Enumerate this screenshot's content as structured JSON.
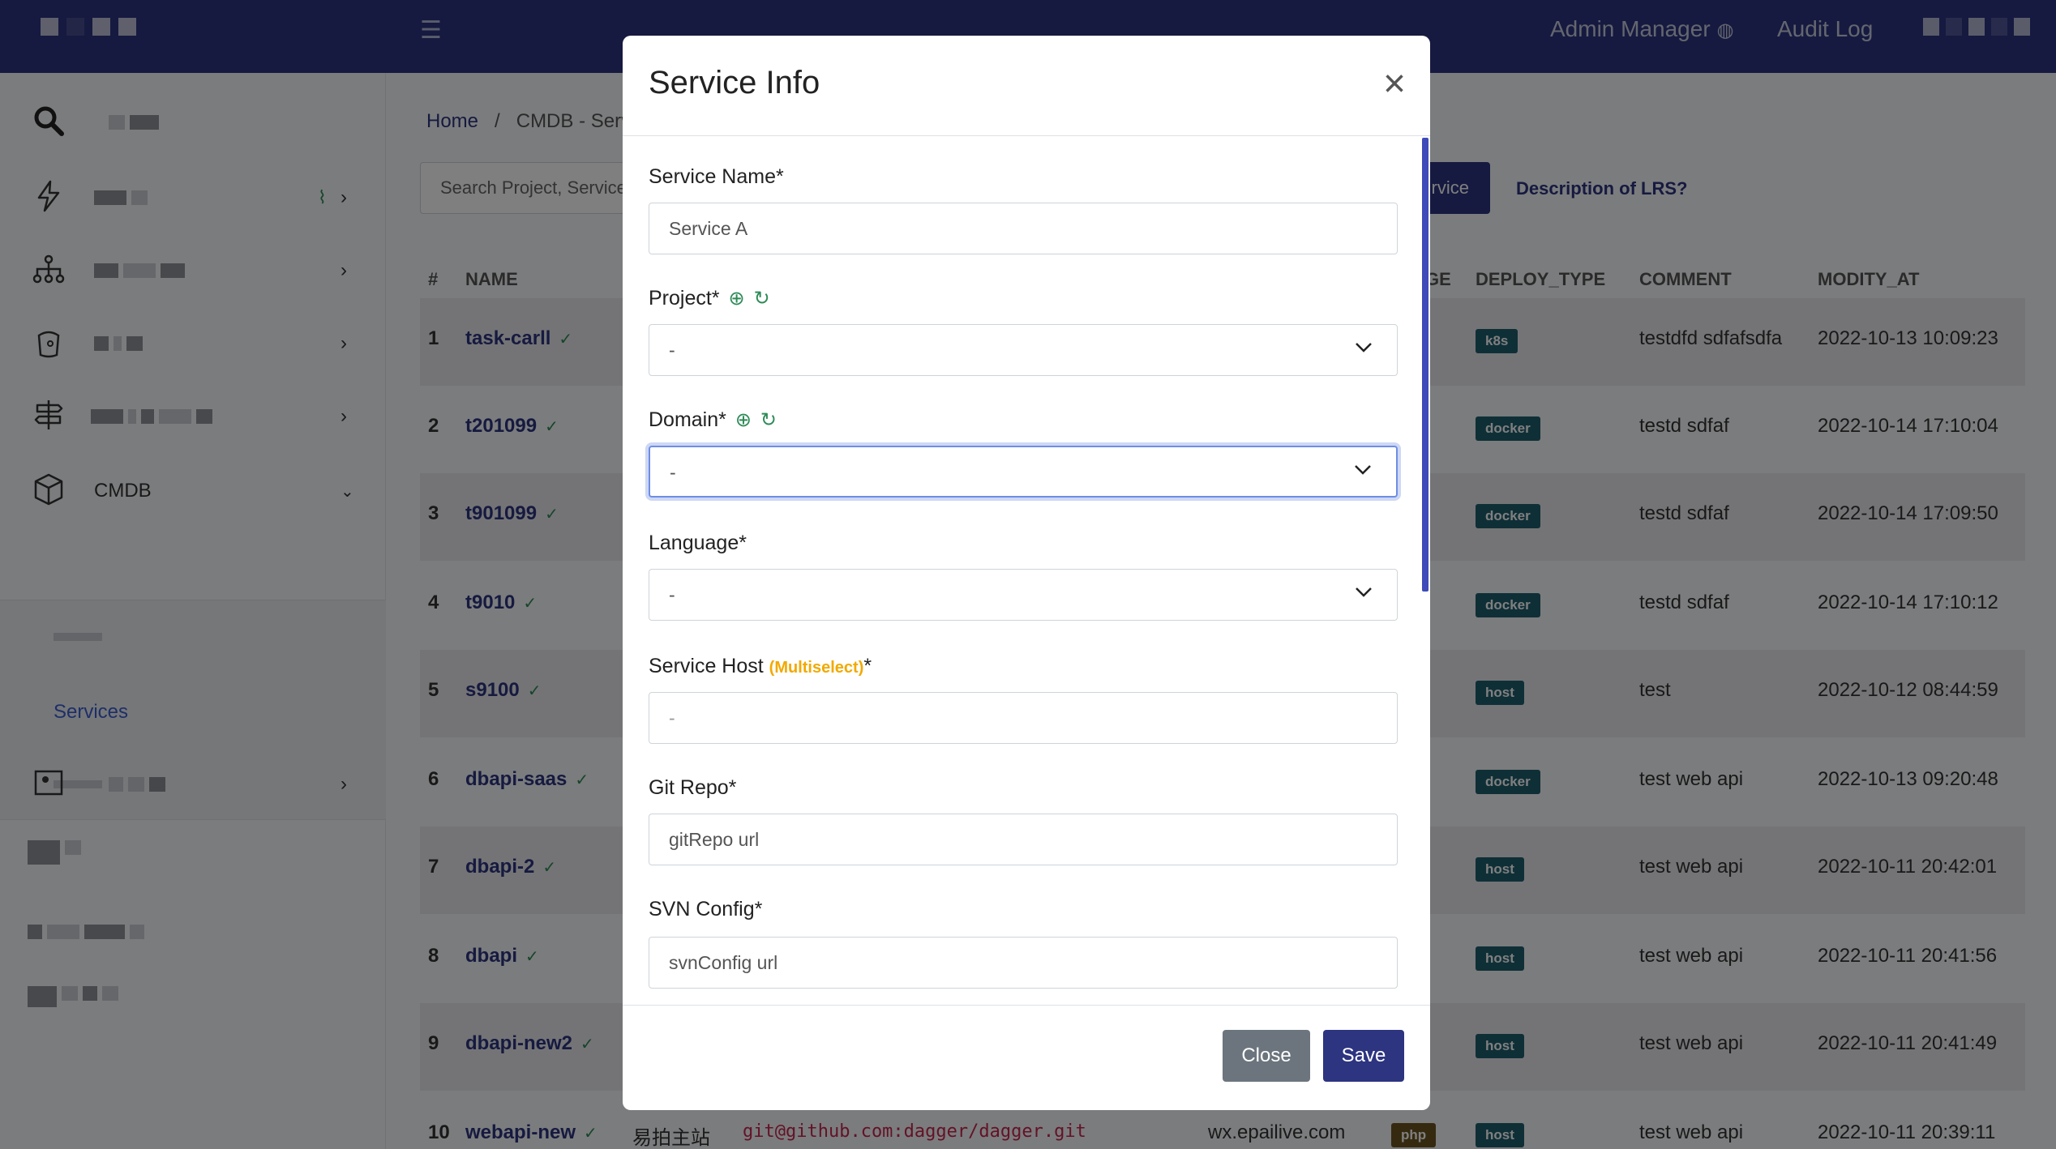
{
  "topbar": {
    "admin_label": "Admin Manager",
    "audit_label": "Audit Log"
  },
  "sidebar": {
    "cmdb_label": "CMDB",
    "services_label": "Services"
  },
  "main": {
    "breadcrumb_home": "Home",
    "breadcrumb_sep": "/",
    "breadcrumb_current": "CMDB - Servi",
    "search_placeholder": "Search Project, Service",
    "add_service_label": "rvice",
    "desc_link": "Description of LRS?",
    "columns": {
      "index": "#",
      "name": "NAME",
      "language_tail": "GE",
      "deploy_type": "DEPLOY_TYPE",
      "comment": "COMMENT",
      "modify_at": "MODITY_AT"
    },
    "rows": [
      {
        "index": "1",
        "name": "task-carll",
        "deploy": "k8s",
        "comment": "testdfd sdfafsdfa",
        "modify_at": "2022-10-13 10:09:23"
      },
      {
        "index": "2",
        "name": "t201099",
        "deploy": "docker",
        "comment": "testd sdfaf",
        "modify_at": "2022-10-14 17:10:04"
      },
      {
        "index": "3",
        "name": "t901099",
        "deploy": "docker",
        "comment": "testd sdfaf",
        "modify_at": "2022-10-14 17:09:50"
      },
      {
        "index": "4",
        "name": "t9010",
        "deploy": "docker",
        "comment": "testd sdfaf",
        "modify_at": "2022-10-14 17:10:12"
      },
      {
        "index": "5",
        "name": "s9100",
        "deploy": "host",
        "comment": "test",
        "modify_at": "2022-10-12 08:44:59"
      },
      {
        "index": "6",
        "name": "dbapi-saas",
        "deploy": "docker",
        "comment": "test web api",
        "modify_at": "2022-10-13 09:20:48"
      },
      {
        "index": "7",
        "name": "dbapi-2",
        "deploy": "host",
        "comment": "test web api",
        "modify_at": "2022-10-11 20:42:01"
      },
      {
        "index": "8",
        "name": "dbapi",
        "deploy": "host",
        "comment": "test web api",
        "modify_at": "2022-10-11 20:41:56"
      },
      {
        "index": "9",
        "name": "dbapi-new2",
        "deploy": "host",
        "comment": "test web api",
        "modify_at": "2022-10-11 20:41:49"
      },
      {
        "index": "10",
        "name": "webapi-new",
        "deploy": "host",
        "comment": "test web api",
        "modify_at": "2022-10-11 20:39:11",
        "project": "易拍主站",
        "repo": "git@github.com:dagger/dagger.git",
        "domain": "wx.epailive.com",
        "language": "php"
      }
    ]
  },
  "modal": {
    "title": "Service Info",
    "service_name_label": "Service Name*",
    "service_name_placeholder": "Service A",
    "project_label": "Project*",
    "project_value": "-",
    "domain_label": "Domain*",
    "domain_value": "-",
    "language_label": "Language*",
    "language_value": "-",
    "service_host_label": "Service Host",
    "service_host_multi": "(Multiselect)",
    "service_host_star": "*",
    "service_host_value": "-",
    "git_repo_label": "Git Repo*",
    "git_repo_placeholder": "gitRepo url",
    "svn_label": "SVN Config*",
    "svn_placeholder": "svnConfig url",
    "close_label": "Close",
    "save_label": "Save"
  }
}
